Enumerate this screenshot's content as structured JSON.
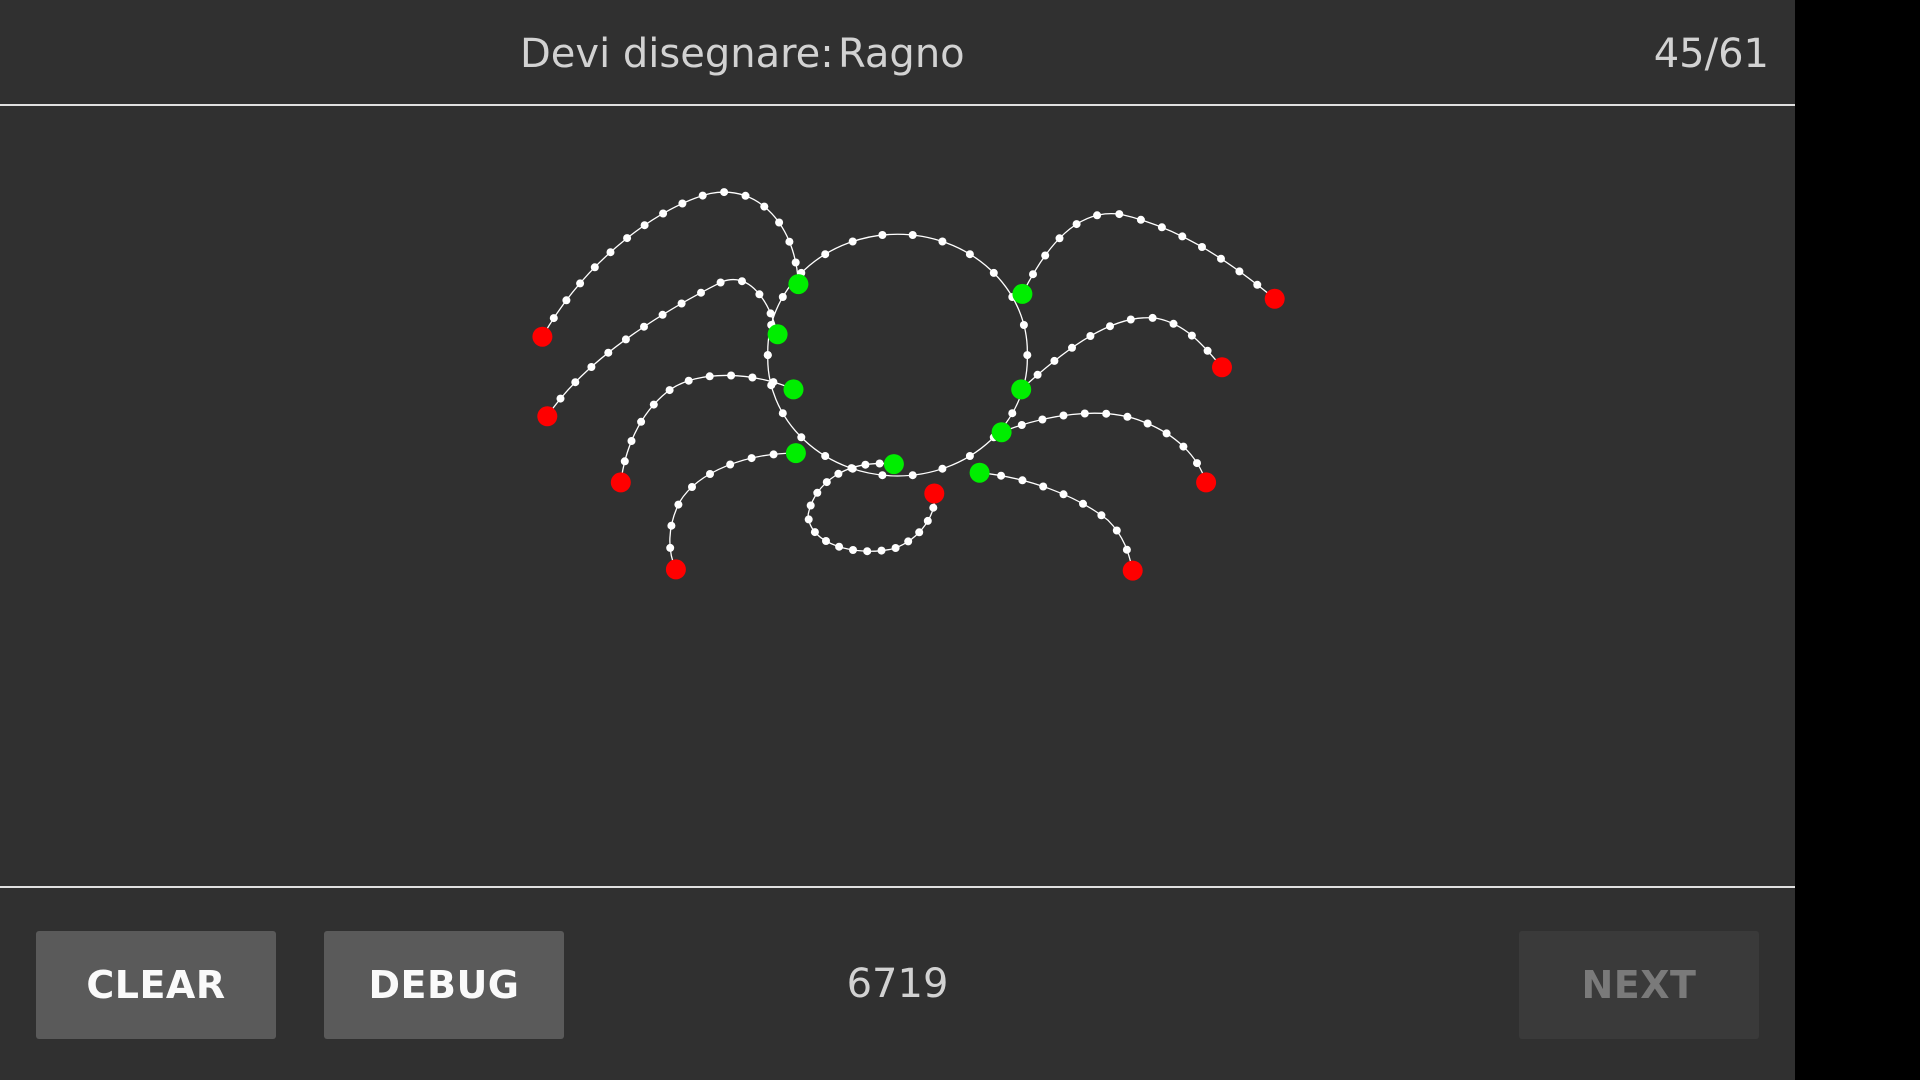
{
  "header": {
    "prompt_label": "Devi disegnare:",
    "prompt_word": "Ragno",
    "progress": "45/61"
  },
  "footer": {
    "clear_label": "CLEAR",
    "debug_label": "DEBUG",
    "score": "6719",
    "next_label": "NEXT",
    "next_enabled": false
  },
  "drawing": {
    "subject": "spider",
    "stroke_color": "#ffffff",
    "leg_start_color": "#00ee00",
    "leg_end_color": "#ff0000",
    "leg_count": 8
  }
}
